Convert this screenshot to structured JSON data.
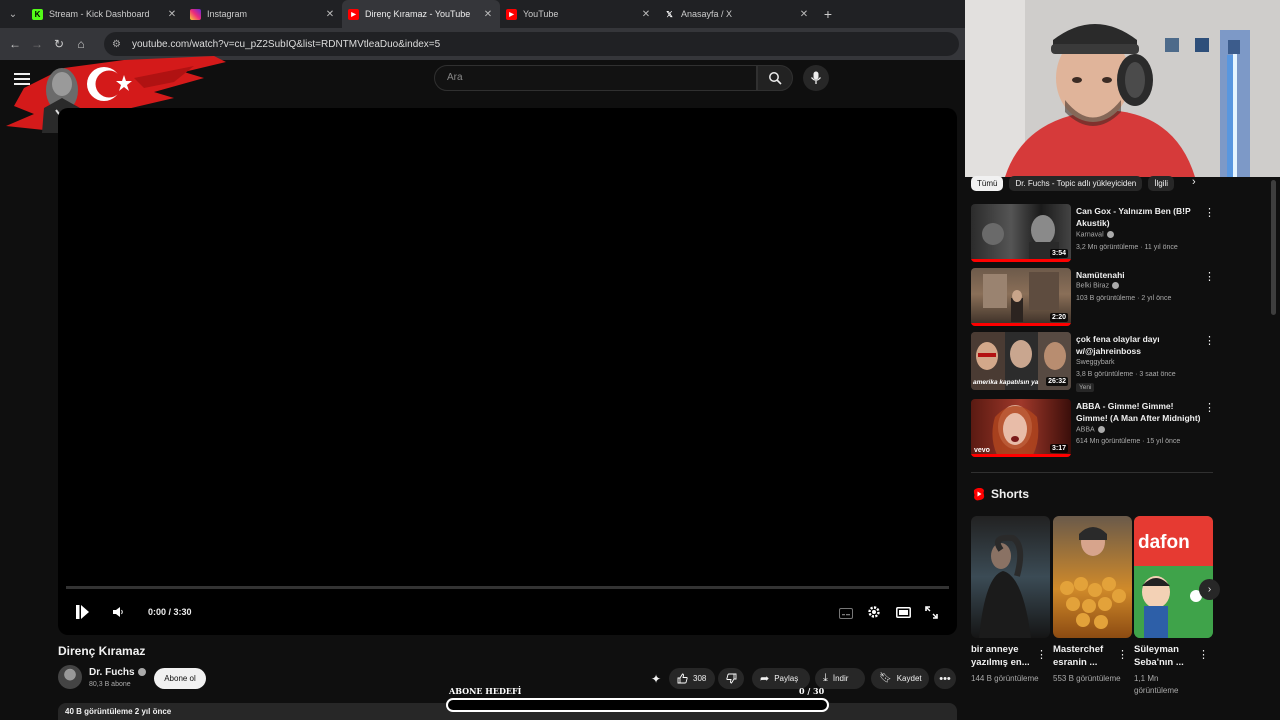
{
  "browser": {
    "tabs": [
      {
        "label": "Stream - Kick Dashboard",
        "icon": "kick-icon",
        "color": "#53fc18"
      },
      {
        "label": "Instagram",
        "icon": "instagram-icon",
        "color": "#e1306c"
      },
      {
        "label": "Direnç Kıramaz - YouTube",
        "icon": "youtube-icon",
        "color": "#ff0000",
        "active": true
      },
      {
        "label": "YouTube",
        "icon": "youtube-icon",
        "color": "#ff0000"
      },
      {
        "label": "Anasayfa / X",
        "icon": "x-icon",
        "color": "#ffffff"
      }
    ],
    "url": "youtube.com/watch?v=cu_pZ2SubIQ&list=RDNTMVtleaDuo&index=5"
  },
  "header": {
    "search_placeholder": "Ara"
  },
  "player": {
    "time": "0:00 / 3:30",
    "progress": 0
  },
  "video": {
    "title": "Direnç Kıramaz",
    "channel": "Dr. Fuchs",
    "subs": "80,3 B abone",
    "subscribe_label": "Abone ol",
    "likes": "308",
    "share_label": "Paylaş",
    "download_label": "İndir",
    "save_label": "Kaydet",
    "views_date": "40 B görüntüleme  2 yıl önce"
  },
  "goal": {
    "label": "ABONE HEDEFİ",
    "count": "0   / 30",
    "progress": 0
  },
  "sidebar": {
    "chips": [
      "Tümü",
      "Dr. Fuchs - Topic adlı yükleyiciden",
      "İlgili"
    ],
    "recs": [
      {
        "title": "Can Gox - Yalnızım Ben (B!P Akustik)",
        "channel": "Karnaval",
        "meta": "3,2 Mn görüntüleme · 11 yıl önce",
        "duration": "3:54"
      },
      {
        "title": "Namütenahi",
        "channel": "Belki Biraz",
        "meta": "103 B görüntüleme · 2 yıl önce",
        "duration": "2:20"
      },
      {
        "title": "çok fena olaylar dayı w/@jahreinboss",
        "channel": "Sweggybark",
        "meta": "3,8 B görüntüleme · 3 saat önce",
        "duration": "26:32",
        "badge": "Yeni",
        "thumb_caption": "amerika kapatılsın ya"
      },
      {
        "title": "ABBA - Gimme! Gimme! Gimme! (A Man After Midnight)",
        "channel": "ABBA",
        "meta": "614 Mn görüntüleme · 15 yıl önce",
        "duration": "3:17",
        "thumb_caption": "vevo"
      }
    ],
    "shorts_heading": "Shorts",
    "shorts": [
      {
        "title": "bir anneye yazılmış en...",
        "views": "144 B görüntüleme"
      },
      {
        "title": "Masterchef esranin ...",
        "views": "553 B görüntüleme"
      },
      {
        "title": "Süleyman Seba'nın ...",
        "views": "1,1 Mn görüntüleme",
        "thumb_text": "dafon"
      }
    ]
  },
  "colors": {
    "youtube_red": "#ff0000",
    "background": "#0f0f0f",
    "kick_green": "#53fc18"
  }
}
